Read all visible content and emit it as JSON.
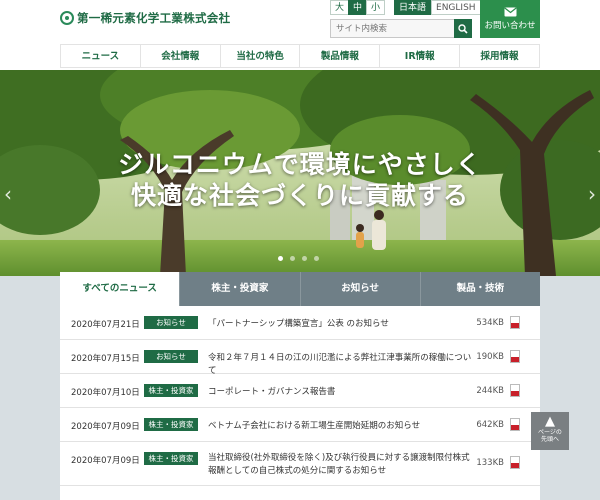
{
  "header": {
    "company_name": "第一稀元素化学工業株式会社",
    "font_sizes": [
      "大",
      "中",
      "小"
    ],
    "languages": [
      "日本語",
      "ENGLISH"
    ],
    "search_placeholder": "サイト内検索",
    "contact_label": "お問い合わせ"
  },
  "nav": {
    "items": [
      "ニュース",
      "会社情報",
      "当社の特色",
      "製品情報",
      "IR情報",
      "採用情報"
    ]
  },
  "hero": {
    "line1": "ジルコニウムで環境にやさしく",
    "line2": "快適な社会づくりに貢献する",
    "slide_count": 4,
    "active_slide": 1
  },
  "news": {
    "tabs": [
      "すべてのニュース",
      "株主・投資家",
      "お知らせ",
      "製品・技術"
    ],
    "rows": [
      {
        "date": "2020年07月21日",
        "category": "お知らせ",
        "title": "「パートナーシップ構築宣言」公表 のお知らせ",
        "size": "534KB"
      },
      {
        "date": "2020年07月15日",
        "category": "お知らせ",
        "title": "令和２年７月１４日の江の川氾濫による弊社江津事業所の稼働について",
        "size": "190KB"
      },
      {
        "date": "2020年07月10日",
        "category": "株主・投資家",
        "title": "コーポレート・ガバナンス報告書",
        "size": "244KB"
      },
      {
        "date": "2020年07月09日",
        "category": "株主・投資家",
        "title": "ベトナム子会社における新工場生産開始延期のお知らせ",
        "size": "642KB"
      },
      {
        "date": "2020年07月09日",
        "category": "株主・投資家",
        "title": "当社取締役(社外取締役を除く)及び執行役員に対する譲渡制限付株式報酬としての自己株式の処分に関するお知らせ",
        "size": "133KB"
      }
    ]
  },
  "page_top": {
    "label_line1": "ページの",
    "label_line2": "先頭へ"
  },
  "colors": {
    "brand_green": "#1f6b45",
    "contact_green": "#2c8f4c",
    "tab_gray": "#6f7f87"
  }
}
